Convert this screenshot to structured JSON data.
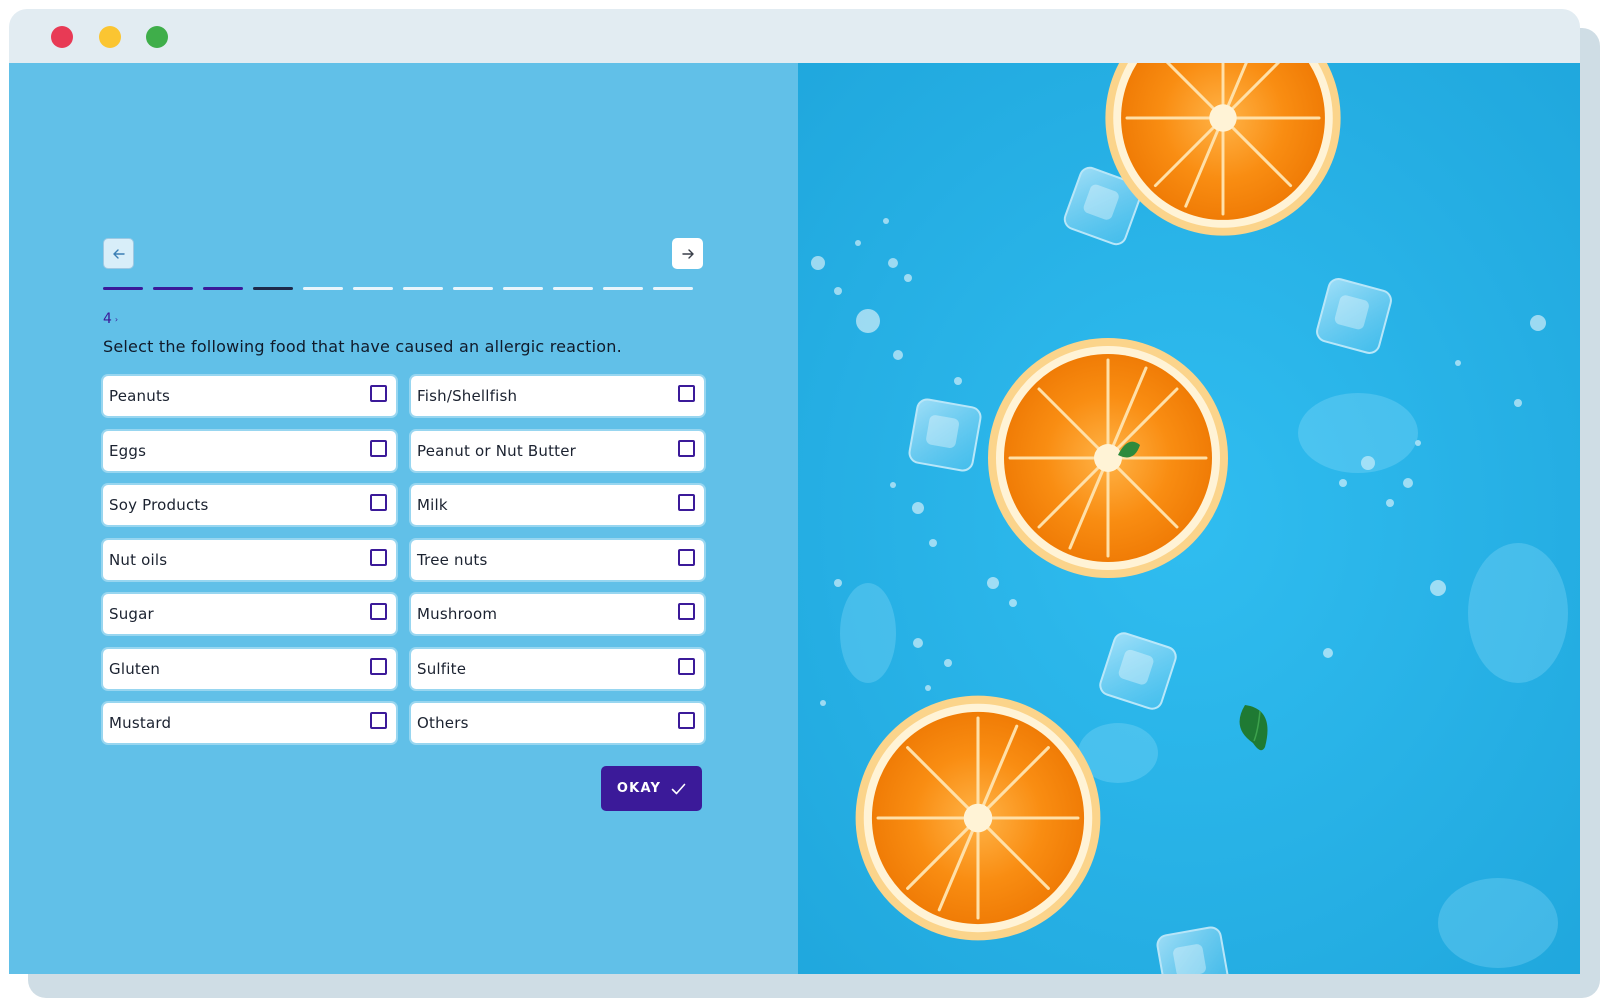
{
  "window": {
    "controls": [
      "close",
      "minimize",
      "maximize"
    ],
    "colors": {
      "red": "#e83a55",
      "yellow": "#fbc531",
      "green": "#3fae4a"
    }
  },
  "navigation": {
    "back_icon": "arrow-left-icon",
    "next_icon": "arrow-right-icon"
  },
  "progress": {
    "total_steps": 12,
    "completed_steps": 3,
    "current_step": 4
  },
  "question": {
    "number": "4",
    "text": "Select the following food that have caused an allergic reaction."
  },
  "options": [
    {
      "label": "Peanuts",
      "checked": false
    },
    {
      "label": "Fish/Shellfish",
      "checked": false
    },
    {
      "label": "Eggs",
      "checked": false
    },
    {
      "label": "Peanut or Nut Butter",
      "checked": false
    },
    {
      "label": "Soy Products",
      "checked": false
    },
    {
      "label": "Milk",
      "checked": false
    },
    {
      "label": "Nut oils",
      "checked": false
    },
    {
      "label": "Tree nuts",
      "checked": false
    },
    {
      "label": "Sugar",
      "checked": false
    },
    {
      "label": "Mushroom",
      "checked": false
    },
    {
      "label": "Gluten",
      "checked": false
    },
    {
      "label": "Sulfite",
      "checked": false
    },
    {
      "label": "Mustard",
      "checked": false
    },
    {
      "label": "Others",
      "checked": false
    }
  ],
  "submit": {
    "label": "OKAY",
    "icon": "checkmark-icon"
  },
  "colors": {
    "accent": "#3b1a99",
    "left_panel": "#61c0e8",
    "right_panel": "#2bb5ea",
    "orange": "#f7941d"
  }
}
